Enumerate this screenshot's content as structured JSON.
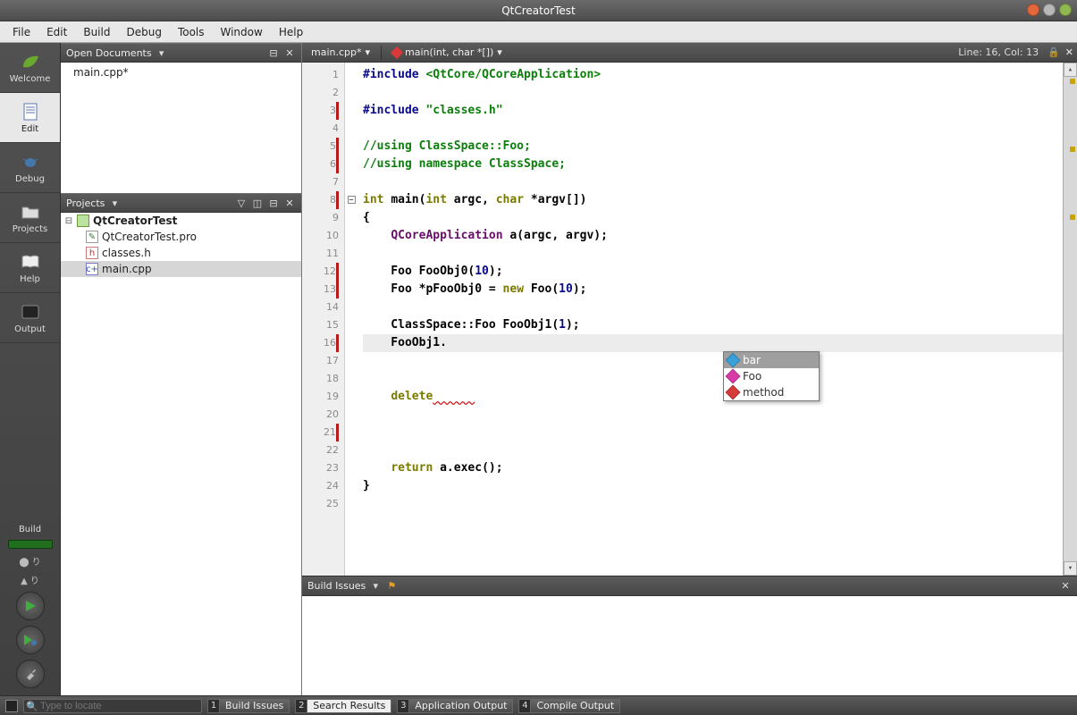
{
  "window": {
    "title": "QtCreatorTest"
  },
  "menu": [
    "File",
    "Edit",
    "Build",
    "Debug",
    "Tools",
    "Window",
    "Help"
  ],
  "modes": [
    {
      "id": "welcome",
      "label": "Welcome"
    },
    {
      "id": "edit",
      "label": "Edit",
      "active": true
    },
    {
      "id": "debug",
      "label": "Debug"
    },
    {
      "id": "projects",
      "label": "Projects"
    },
    {
      "id": "help",
      "label": "Help"
    },
    {
      "id": "output",
      "label": "Output"
    }
  ],
  "build_label": "Build",
  "open_documents": {
    "title": "Open Documents",
    "items": [
      "main.cpp*"
    ]
  },
  "projects_pane": {
    "title": "Projects",
    "tree": {
      "root": "QtCreatorTest",
      "children": [
        {
          "name": "QtCreatorTest.pro",
          "kind": "pro"
        },
        {
          "name": "classes.h",
          "kind": "h"
        },
        {
          "name": "main.cpp",
          "kind": "cpp",
          "selected": true
        }
      ]
    }
  },
  "editor": {
    "file_tab": "main.cpp*",
    "symbol_tab": "main(int, char *[])",
    "status": "Line: 16, Col: 13",
    "changed_lines": [
      3,
      5,
      6,
      8,
      12,
      13,
      16,
      21
    ],
    "fold_at": 8,
    "highlight_line": 16,
    "lines": [
      {
        "n": 1,
        "tokens": [
          [
            "kw-pp",
            "#include "
          ],
          [
            "kw-inc",
            "<QtCore/QCoreApplication>"
          ]
        ]
      },
      {
        "n": 2,
        "tokens": [
          [
            "",
            ""
          ]
        ]
      },
      {
        "n": 3,
        "tokens": [
          [
            "kw-pp",
            "#include "
          ],
          [
            "kw-inc",
            "\"classes.h\""
          ]
        ]
      },
      {
        "n": 4,
        "tokens": [
          [
            "",
            ""
          ]
        ]
      },
      {
        "n": 5,
        "tokens": [
          [
            "kw-cmt",
            "//using ClassSpace::Foo;"
          ]
        ]
      },
      {
        "n": 6,
        "tokens": [
          [
            "kw-cmt",
            "//using namespace ClassSpace;"
          ]
        ]
      },
      {
        "n": 7,
        "tokens": [
          [
            "",
            ""
          ]
        ]
      },
      {
        "n": 8,
        "tokens": [
          [
            "kw-type",
            "int "
          ],
          [
            "",
            "main("
          ],
          [
            "kw-type",
            "int "
          ],
          [
            "",
            "argc, "
          ],
          [
            "kw-type",
            "char "
          ],
          [
            "",
            "*argv[])"
          ]
        ]
      },
      {
        "n": 9,
        "tokens": [
          [
            "",
            "{"
          ]
        ]
      },
      {
        "n": 10,
        "tokens": [
          [
            "",
            "    "
          ],
          [
            "kw-cls",
            "QCoreApplication"
          ],
          [
            "",
            " a(argc, argv);"
          ]
        ]
      },
      {
        "n": 11,
        "tokens": [
          [
            "",
            ""
          ]
        ]
      },
      {
        "n": 12,
        "tokens": [
          [
            "",
            "    Foo FooObj0("
          ],
          [
            "kw-num",
            "10"
          ],
          [
            "",
            ");"
          ]
        ]
      },
      {
        "n": 13,
        "tokens": [
          [
            "",
            "    Foo *pFooObj0 = "
          ],
          [
            "kw-kw",
            "new"
          ],
          [
            "",
            " Foo("
          ],
          [
            "kw-num",
            "10"
          ],
          [
            "",
            ");"
          ]
        ]
      },
      {
        "n": 14,
        "tokens": [
          [
            "",
            ""
          ]
        ]
      },
      {
        "n": 15,
        "tokens": [
          [
            "",
            "    ClassSpace::Foo FooObj1("
          ],
          [
            "kw-num",
            "1"
          ],
          [
            "",
            ");"
          ]
        ]
      },
      {
        "n": 16,
        "tokens": [
          [
            "",
            "    FooObj1."
          ]
        ]
      },
      {
        "n": 17,
        "tokens": [
          [
            "",
            ""
          ]
        ]
      },
      {
        "n": 18,
        "tokens": [
          [
            "",
            ""
          ]
        ]
      },
      {
        "n": 19,
        "tokens": [
          [
            "",
            "    "
          ],
          [
            "kw-kw",
            "delete"
          ],
          [
            "kw-err",
            "      "
          ]
        ]
      },
      {
        "n": 20,
        "tokens": [
          [
            "",
            ""
          ]
        ]
      },
      {
        "n": 21,
        "tokens": [
          [
            "",
            ""
          ]
        ]
      },
      {
        "n": 22,
        "tokens": [
          [
            "",
            ""
          ]
        ]
      },
      {
        "n": 23,
        "tokens": [
          [
            "",
            "    "
          ],
          [
            "kw-kw",
            "return"
          ],
          [
            "",
            " a.exec();"
          ]
        ]
      },
      {
        "n": 24,
        "tokens": [
          [
            "",
            "}"
          ]
        ]
      },
      {
        "n": 25,
        "tokens": [
          [
            "",
            ""
          ]
        ]
      }
    ]
  },
  "autocomplete": {
    "items": [
      {
        "label": "bar",
        "color": "#3aa0d8",
        "selected": true
      },
      {
        "label": "Foo",
        "color": "#d83aa7"
      },
      {
        "label": "method",
        "color": "#d83a3a"
      }
    ]
  },
  "bottom_panel": {
    "title": "Build Issues"
  },
  "statusbar": {
    "locator_placeholder": "Type to locate",
    "outputs": [
      {
        "n": "1",
        "label": "Build Issues"
      },
      {
        "n": "2",
        "label": "Search Results"
      },
      {
        "n": "3",
        "label": "Application Output"
      },
      {
        "n": "4",
        "label": "Compile Output"
      }
    ]
  },
  "colors": {
    "traffic_close": "#e2673d",
    "traffic_min": "#b8b8b8",
    "traffic_max": "#8fb84f"
  }
}
